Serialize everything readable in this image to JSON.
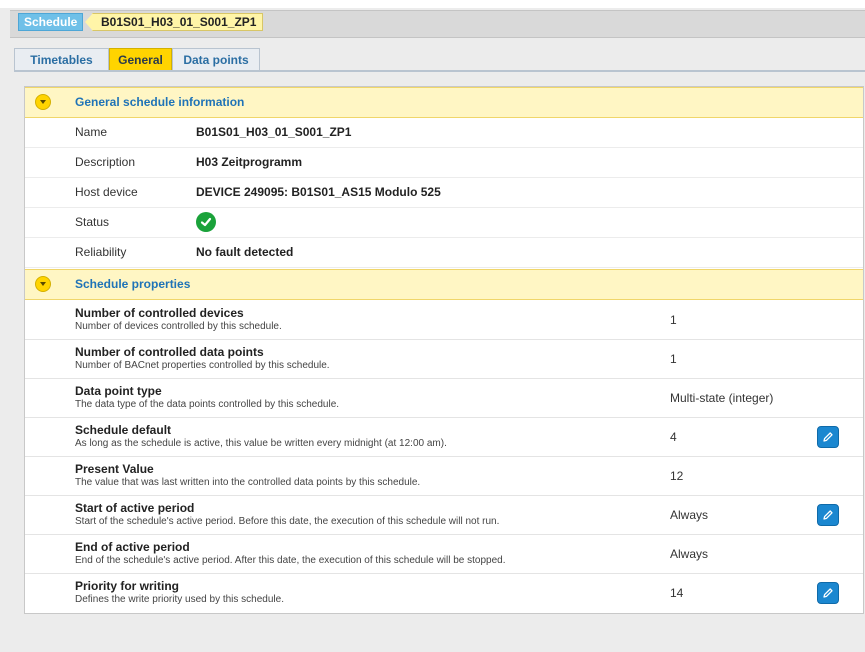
{
  "breadcrumb": {
    "root": "Schedule",
    "current": "B01S01_H03_01_S001_ZP1"
  },
  "tabs": [
    {
      "label": "Timetables",
      "active": false
    },
    {
      "label": "General",
      "active": true
    },
    {
      "label": "Data points",
      "active": false
    }
  ],
  "general": {
    "title": "General schedule information",
    "rows": [
      {
        "label": "Name",
        "value": "B01S01_H03_01_S001_ZP1"
      },
      {
        "label": "Description",
        "value": "H03 Zeitprogramm"
      },
      {
        "label": "Host device",
        "value": "DEVICE 249095: B01S01_AS15 Modulo 525"
      },
      {
        "label": "Status",
        "icon": "check-circle-icon"
      },
      {
        "label": "Reliability",
        "value": "No fault detected"
      }
    ]
  },
  "properties": {
    "title": "Schedule properties",
    "rows": [
      {
        "title": "Number of controlled devices",
        "desc": "Number of devices controlled by this schedule.",
        "value": "1",
        "editable": false
      },
      {
        "title": "Number of controlled data points",
        "desc": "Number of BACnet properties controlled by this schedule.",
        "value": "1",
        "editable": false
      },
      {
        "title": "Data point type",
        "desc": "The data type of the data points controlled by this schedule.",
        "value": "Multi-state (integer)",
        "editable": false
      },
      {
        "title": "Schedule default",
        "desc": "As long as the schedule is active, this value be written every midnight (at 12:00 am).",
        "value": "4",
        "editable": true
      },
      {
        "title": "Present Value",
        "desc": "The value that was last written into the controlled data points by this schedule.",
        "value": "12",
        "editable": false
      },
      {
        "title": "Start of active period",
        "desc": "Start of the schedule's active period. Before this date, the execution of this schedule will not run.",
        "value": "Always",
        "editable": true
      },
      {
        "title": "End of active period",
        "desc": "End of the schedule's active period. After this date, the execution of this schedule will be stopped.",
        "value": "Always",
        "editable": false
      },
      {
        "title": "Priority for writing",
        "desc": "Defines the write priority used by this schedule.",
        "value": "14",
        "editable": true
      }
    ]
  },
  "colors": {
    "accent": "#ffd400",
    "link": "#1f73b7",
    "section_bg": "#fff6c4",
    "success": "#1aa23a",
    "edit_button": "#1b87d0"
  }
}
